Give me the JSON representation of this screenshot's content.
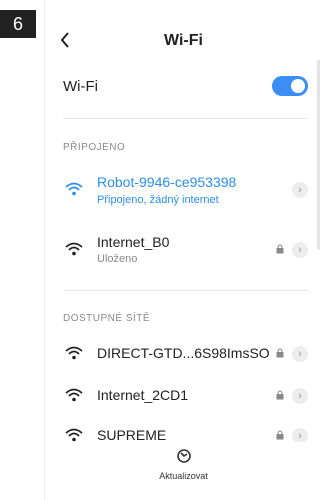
{
  "step": "6",
  "header": {
    "back_icon": "‹",
    "title": "Wi-Fi"
  },
  "wifi": {
    "label": "Wi-Fi",
    "enabled": true,
    "accent": "#3a8ef6"
  },
  "connected": {
    "heading": "PŘIPOJENO",
    "networks": [
      {
        "name": "Robot-9946-ce953398",
        "status": "Připojeno, žádný internet",
        "active": true,
        "locked": false
      },
      {
        "name": "Internet_B0",
        "status": "Uloženo",
        "active": false,
        "locked": true
      }
    ]
  },
  "available": {
    "heading": "DOSTUPNÉ SÍTĚ",
    "networks": [
      {
        "name": "DIRECT-GTD...6S98ImsSO",
        "locked": true
      },
      {
        "name": "Internet_2CD1",
        "locked": true
      },
      {
        "name": "SUPREME",
        "locked": true
      }
    ]
  },
  "refresh": {
    "label": "Aktualizovat",
    "icon": "refresh-icon"
  }
}
